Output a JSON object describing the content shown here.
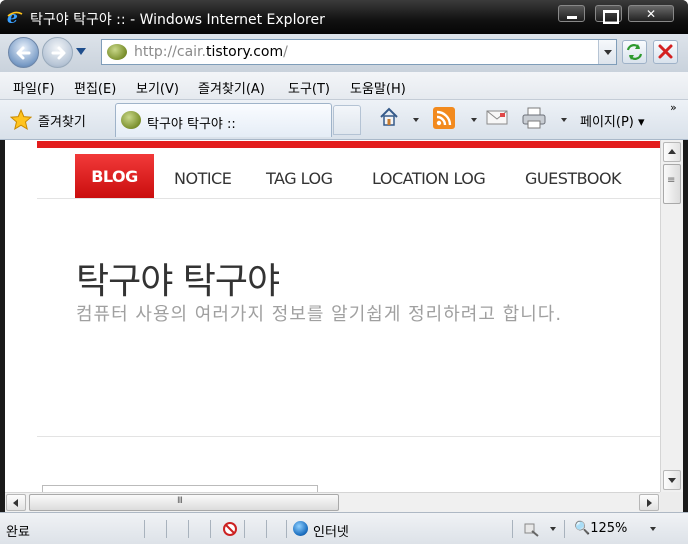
{
  "window": {
    "title": "탁구야 탁구야 :: - Windows Internet Explorer"
  },
  "addressbar": {
    "url_prefix": "http://cair.",
    "url_domain": "tistory.com",
    "url_suffix": "/"
  },
  "menu": {
    "items": [
      "파일(F)",
      "편집(E)",
      "보기(V)",
      "즐겨찾기(A)",
      "도구(T)",
      "도움말(H)"
    ]
  },
  "favorites": {
    "label": "즐겨찾기"
  },
  "tabs": [
    {
      "label": "탁구야 탁구야 ::"
    }
  ],
  "commandbar": {
    "page_label": "페이지(P)",
    "chevrons": "»"
  },
  "blog": {
    "nav": [
      "BLOG",
      "NOTICE",
      "TAG LOG",
      "LOCATION LOG",
      "GUESTBOOK"
    ],
    "title": "탁구야 탁구야",
    "description": "컴퓨터 사용의 여러가지 정보를 알기쉽게 정리하려고 합니다.",
    "accent_color": "#e31c1c"
  },
  "statusbar": {
    "status": "완료",
    "zone": "인터넷",
    "zoom": "125%"
  },
  "colors": {
    "titlebar": "#111111",
    "chrome": "#dde3ea",
    "accent_red": "#e31c1c"
  },
  "icons": {
    "back": "back-arrow-icon",
    "forward": "forward-arrow-icon",
    "refresh": "refresh-icon",
    "stop": "stop-icon",
    "home": "home-icon",
    "feeds": "rss-icon",
    "mail": "mail-icon",
    "print": "print-icon",
    "zone": "globe-icon"
  }
}
